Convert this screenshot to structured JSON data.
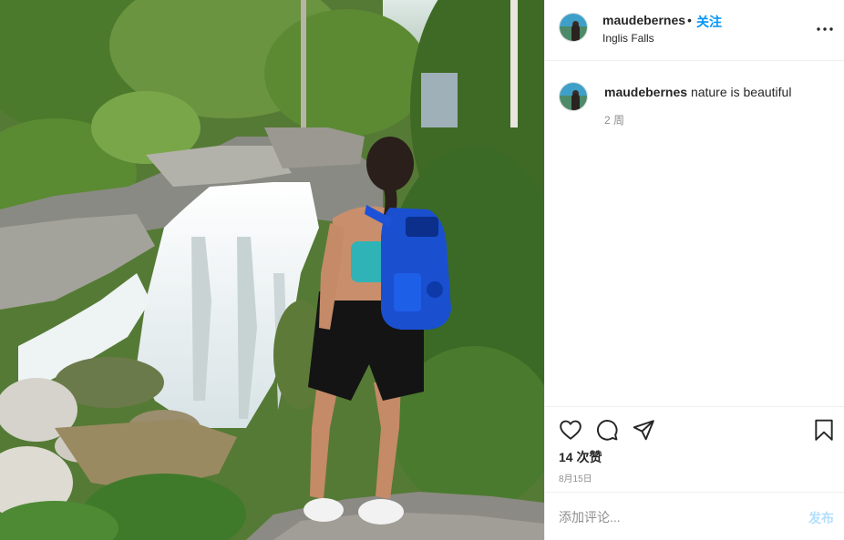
{
  "post": {
    "image_alt": "",
    "header": {
      "username": "maudebernes",
      "separator": "•",
      "follow_label": "关注",
      "location": "Inglis Falls"
    },
    "caption": {
      "username": "maudebernes",
      "text": "nature is beautiful",
      "time": "2 周"
    },
    "actions": {
      "likes": "14 次赞",
      "date": "8月15日"
    },
    "comment": {
      "placeholder": "添加评论...",
      "post_label": "发布"
    }
  },
  "icons": {
    "more": "more-options-icon",
    "like": "heart-icon",
    "comment": "comment-icon",
    "share": "paper-plane-icon",
    "save": "bookmark-icon"
  },
  "colors": {
    "follow": "#0095f6",
    "post_disabled": "#b2dffc",
    "muted": "#8e8e8e",
    "text": "#262626"
  }
}
